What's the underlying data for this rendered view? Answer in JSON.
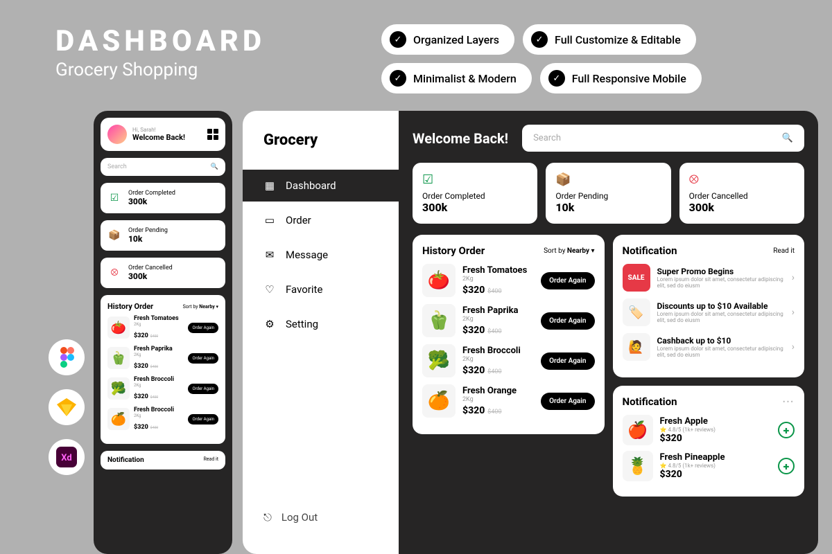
{
  "hero": {
    "title": "DASHBOARD",
    "subtitle": "Grocery Shopping"
  },
  "badges": [
    "Organized Layers",
    "Full Customize & Editable",
    "Minimalist & Modern",
    "Full Responsive Mobile"
  ],
  "mobile": {
    "greeting": "Hi, Sarah!",
    "welcome": "Welcome Back!",
    "searchPlaceholder": "Search",
    "stats": [
      {
        "label": "Order Completed",
        "value": "300k"
      },
      {
        "label": "Order Pending",
        "value": "10k"
      },
      {
        "label": "Order Cancelled",
        "value": "300k"
      }
    ],
    "historyTitle": "History Order",
    "sortLabel": "Sort by",
    "sortValue": "Nearby",
    "items": [
      {
        "name": "Fresh Tomatoes",
        "weight": "2Kg",
        "price": "$320",
        "old": "$400",
        "emoji": "🍅"
      },
      {
        "name": "Fresh Paprika",
        "weight": "2Kg",
        "price": "$320",
        "old": "$400",
        "emoji": "🫑"
      },
      {
        "name": "Fresh Broccoli",
        "weight": "2Kg",
        "price": "$320",
        "old": "$400",
        "emoji": "🥦"
      },
      {
        "name": "Fresh Broccoli",
        "weight": "2Kg",
        "price": "$320",
        "old": "$400",
        "emoji": "🍊"
      }
    ],
    "orderAgain": "Order Again",
    "notifTitle": "Notification",
    "notifAction": "Read it"
  },
  "desktop": {
    "logo": "Grocery",
    "nav": [
      {
        "label": "Dashboard",
        "icon": "▦"
      },
      {
        "label": "Order",
        "icon": "▭"
      },
      {
        "label": "Message",
        "icon": "✉"
      },
      {
        "label": "Favorite",
        "icon": "♡"
      },
      {
        "label": "Setting",
        "icon": "⚙"
      }
    ],
    "logout": "Log Out",
    "welcome": "Welcome Back!",
    "searchPlaceholder": "Search",
    "stats": [
      {
        "label": "Order Completed",
        "value": "300k",
        "icon": "✓",
        "color": "#0a9548"
      },
      {
        "label": "Order Pending",
        "value": "10k",
        "icon": "📦",
        "color": "#7b2cbf"
      },
      {
        "label": "Order Cancelled",
        "value": "300k",
        "icon": "✕",
        "color": "#e63946"
      }
    ],
    "historyTitle": "History Order",
    "sortLabel": "Sort by",
    "sortValue": "Nearby",
    "history": [
      {
        "name": "Fresh Tomatoes",
        "weight": "2Kg",
        "price": "$320",
        "old": "$400",
        "emoji": "🍅"
      },
      {
        "name": "Fresh Paprika",
        "weight": "2Kg",
        "price": "$320",
        "old": "$400",
        "emoji": "🫑"
      },
      {
        "name": "Fresh Broccoli",
        "weight": "2Kg",
        "price": "$320",
        "old": "$400",
        "emoji": "🥦"
      },
      {
        "name": "Fresh Orange",
        "weight": "2Kg",
        "price": "$320",
        "old": "$400",
        "emoji": "🍊"
      }
    ],
    "orderAgain": "Order Again",
    "notif1": {
      "title": "Notification",
      "action": "Read it",
      "items": [
        {
          "title": "Super Promo Begins",
          "desc": "Lorem ipsum dolor sit amet, consectetur adipiscing elit, sed do eiusm",
          "type": "sale"
        },
        {
          "title": "Discounts up to $10 Available",
          "desc": "Lorem ipsum dolor sit amet, consectetur adipiscing elit, sed do eiusm",
          "emoji": "🏷️"
        },
        {
          "title": "Cashback up to $10",
          "desc": "Lorem ipsum dolor sit amet, consectetur adipiscing elit, sed do eiusm",
          "emoji": "🙋"
        }
      ]
    },
    "notif2": {
      "title": "Notification",
      "items": [
        {
          "name": "Fresh Apple",
          "rating": "4.8/5",
          "reviews": "(1k+ reviews)",
          "price": "$320",
          "emoji": "🍎"
        },
        {
          "name": "Fresh Pineapple",
          "rating": "4.8/5",
          "reviews": "(1k+ reviews)",
          "price": "$320",
          "emoji": "🍍"
        }
      ]
    }
  }
}
